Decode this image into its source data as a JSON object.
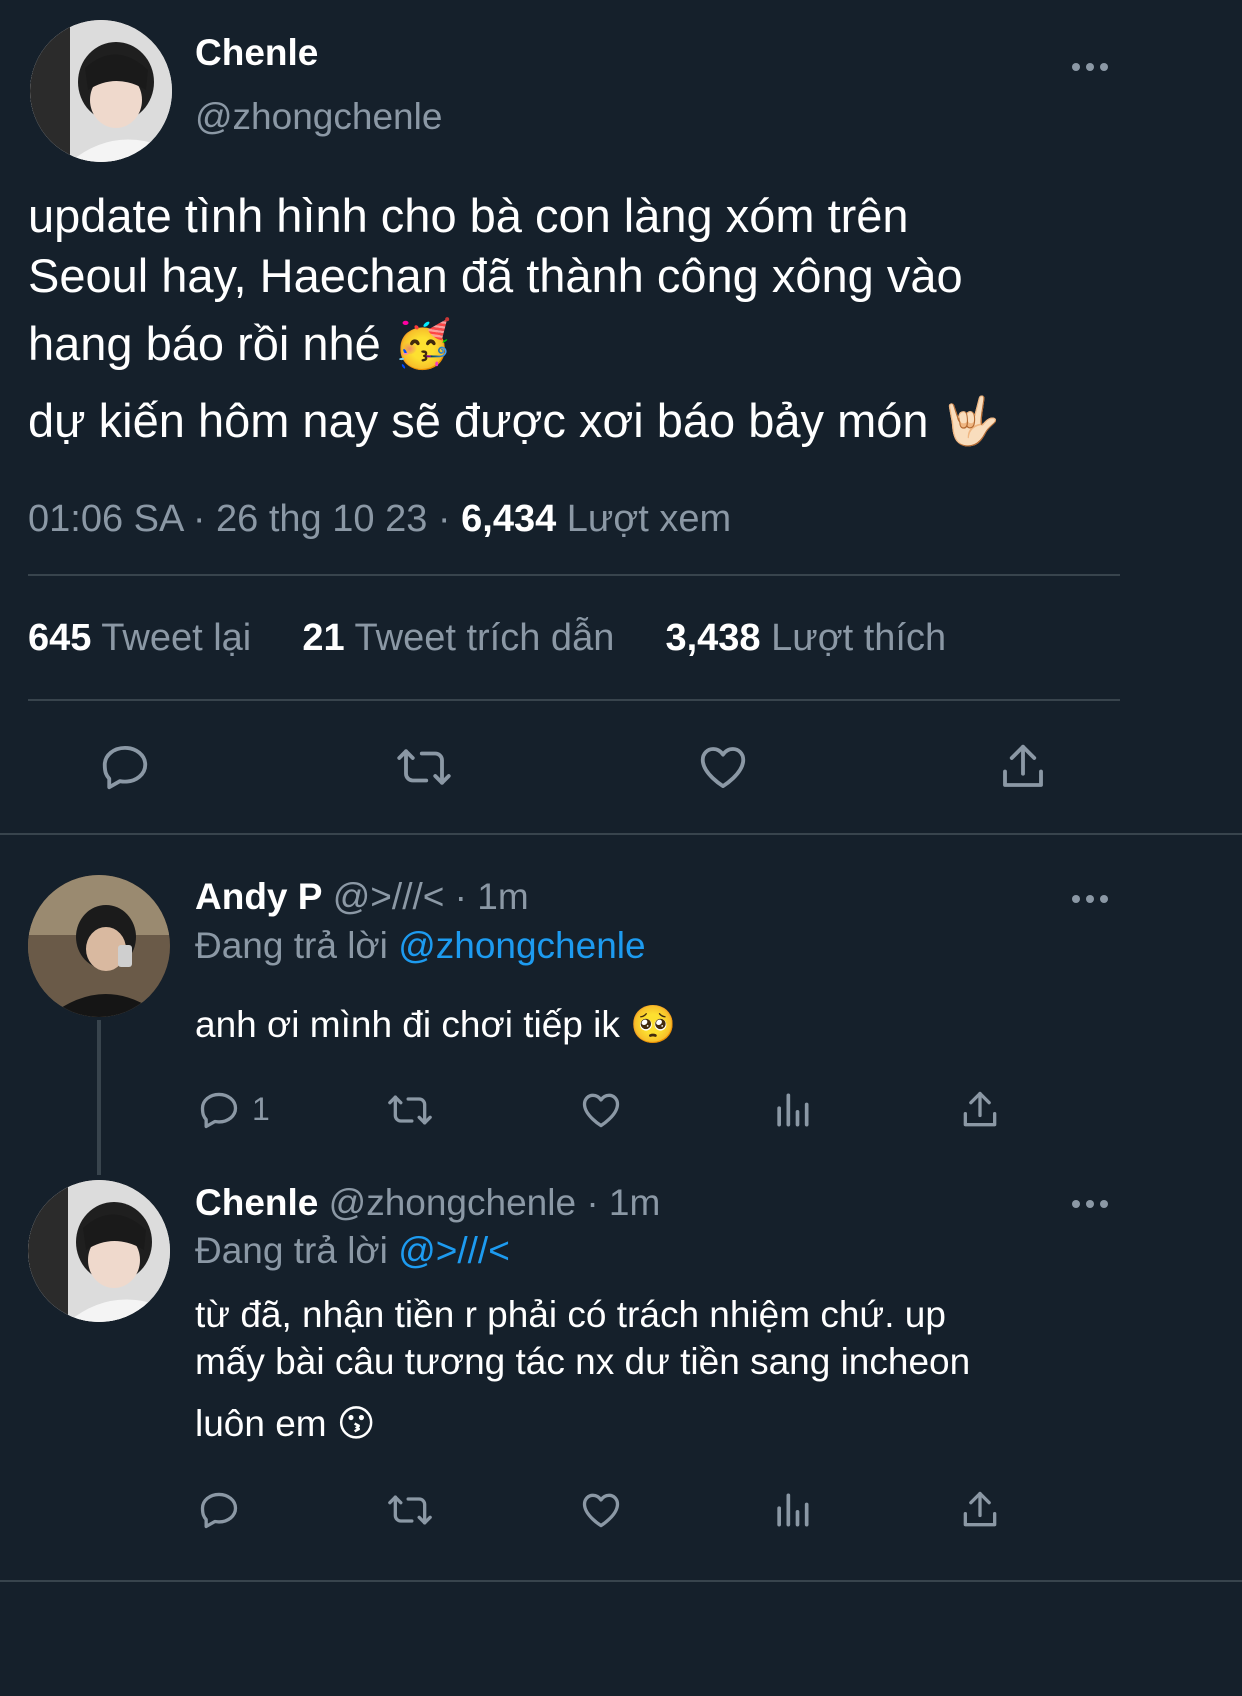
{
  "main_tweet": {
    "display_name": "Chenle",
    "handle": "@zhongchenle",
    "text_line1": "update tình hình cho bà con làng xóm trên",
    "text_line2": "Seoul hay, Haechan đã thành công xông vào",
    "text_line3": "hang báo rồi nhé",
    "text_line3_emoji": "🥳",
    "text_line4": "dự kiến hôm nay sẽ được xơi báo bảy món",
    "text_line4_emoji": "🤟🏻",
    "time": "01:06 SA",
    "separator": "·",
    "date": "26 thg 10 23",
    "views_count": "6,434",
    "views_label": "Lượt xem",
    "retweets_count": "645",
    "retweets_label": "Tweet lại",
    "quotes_count": "21",
    "quotes_label": "Tweet trích dẫn",
    "likes_count": "3,438",
    "likes_label": "Lượt thích",
    "actions": [
      "reply-icon",
      "retweet-icon",
      "like-icon",
      "share-icon"
    ]
  },
  "replies": [
    {
      "display_name": "Andy P",
      "handle": "@>///<",
      "time": "· 1m",
      "replying_label": "Đang trả lời",
      "replying_to": "@zhongchenle",
      "text": "anh ơi mình đi chơi tiếp ik",
      "text_emoji": "🥺",
      "reply_count": "1"
    },
    {
      "display_name": "Chenle",
      "handle": "@zhongchenle",
      "time": "· 1m",
      "replying_label": "Đang trả lời",
      "replying_to": "@>///<",
      "text_line1": "từ đã, nhận tiền r phải có trách nhiệm chứ. up",
      "text_line2": "mấy bài câu tương tác nx dư tiền sang incheon",
      "text_line3": "luôn em",
      "text_emoji": "😗"
    }
  ],
  "colors": {
    "background": "#15202b",
    "muted": "#8b98a5",
    "link": "#1d9bf0",
    "divider": "#38444d"
  }
}
